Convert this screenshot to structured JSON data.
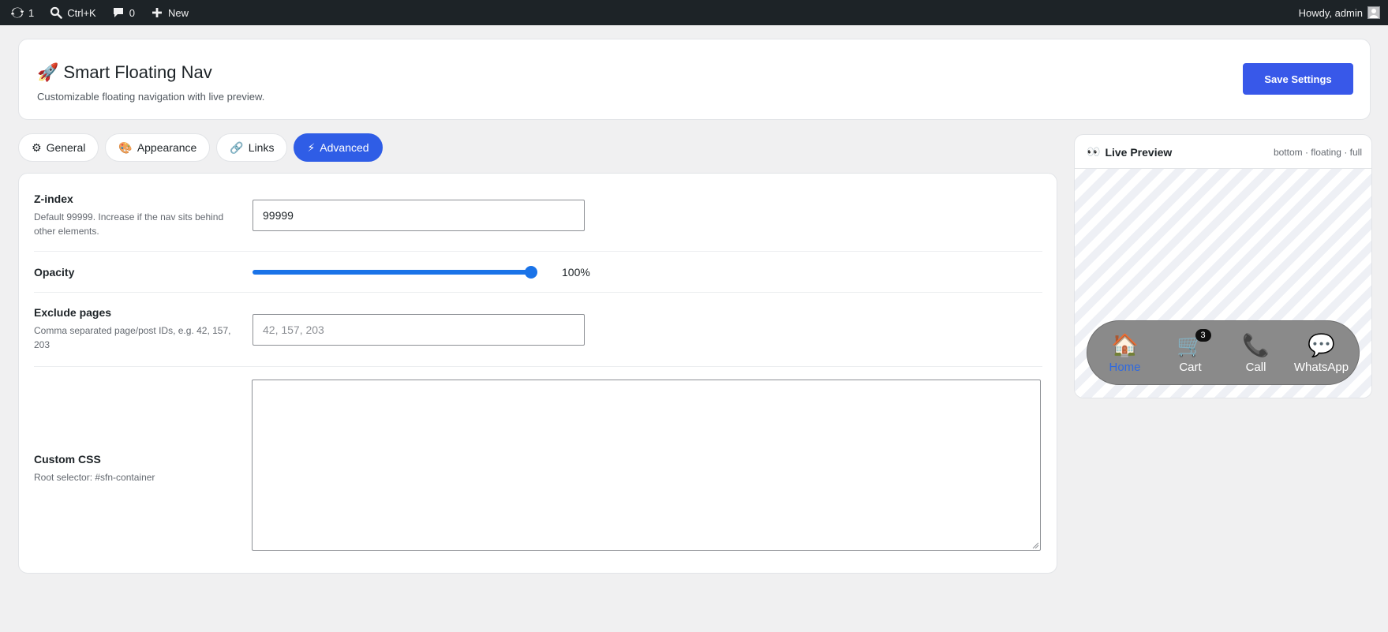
{
  "adminbar": {
    "updates_count": "1",
    "search_shortcut": "Ctrl+K",
    "comments_count": "0",
    "new_label": "New",
    "howdy": "Howdy, admin"
  },
  "header": {
    "title_emoji": "🚀",
    "title": "Smart Floating Nav",
    "subtitle": "Customizable floating navigation with live preview.",
    "save_label": "Save Settings"
  },
  "tabs": [
    {
      "icon": "⚙",
      "label": "General"
    },
    {
      "icon": "🎨",
      "label": "Appearance"
    },
    {
      "icon": "🔗",
      "label": "Links"
    },
    {
      "icon": "⚡",
      "label": "Advanced",
      "active": true
    }
  ],
  "settings": {
    "zindex": {
      "label": "Z-index",
      "desc": "Default 99999. Increase if the nav sits behind other elements.",
      "value": "99999"
    },
    "opacity": {
      "label": "Opacity",
      "value_label": "100%",
      "value": 1.0
    },
    "exclude": {
      "label": "Exclude pages",
      "desc": "Comma separated page/post IDs, e.g. 42, 157, 203",
      "placeholder": "42, 157, 203",
      "value": ""
    },
    "custom_css": {
      "label": "Custom CSS",
      "desc": "Root selector: #sfn-container",
      "value": ""
    }
  },
  "preview": {
    "title_emoji": "👀",
    "title": "Live Preview",
    "meta": "bottom · floating · full",
    "nav_items": [
      {
        "icon": "🏠",
        "label": "Home",
        "active": true
      },
      {
        "icon": "🛒",
        "label": "Cart",
        "badge": "3"
      },
      {
        "icon": "📞",
        "label": "Call"
      },
      {
        "icon": "💬",
        "label": "WhatsApp"
      }
    ]
  },
  "colors": {
    "primary": "#3858e9",
    "tab_active": "#2f5de6",
    "adminbar": "#1d2327",
    "slider": "#1a73e8",
    "nav_bg": "#8a8a8a",
    "nav_active_label": "#2f6ae0"
  }
}
